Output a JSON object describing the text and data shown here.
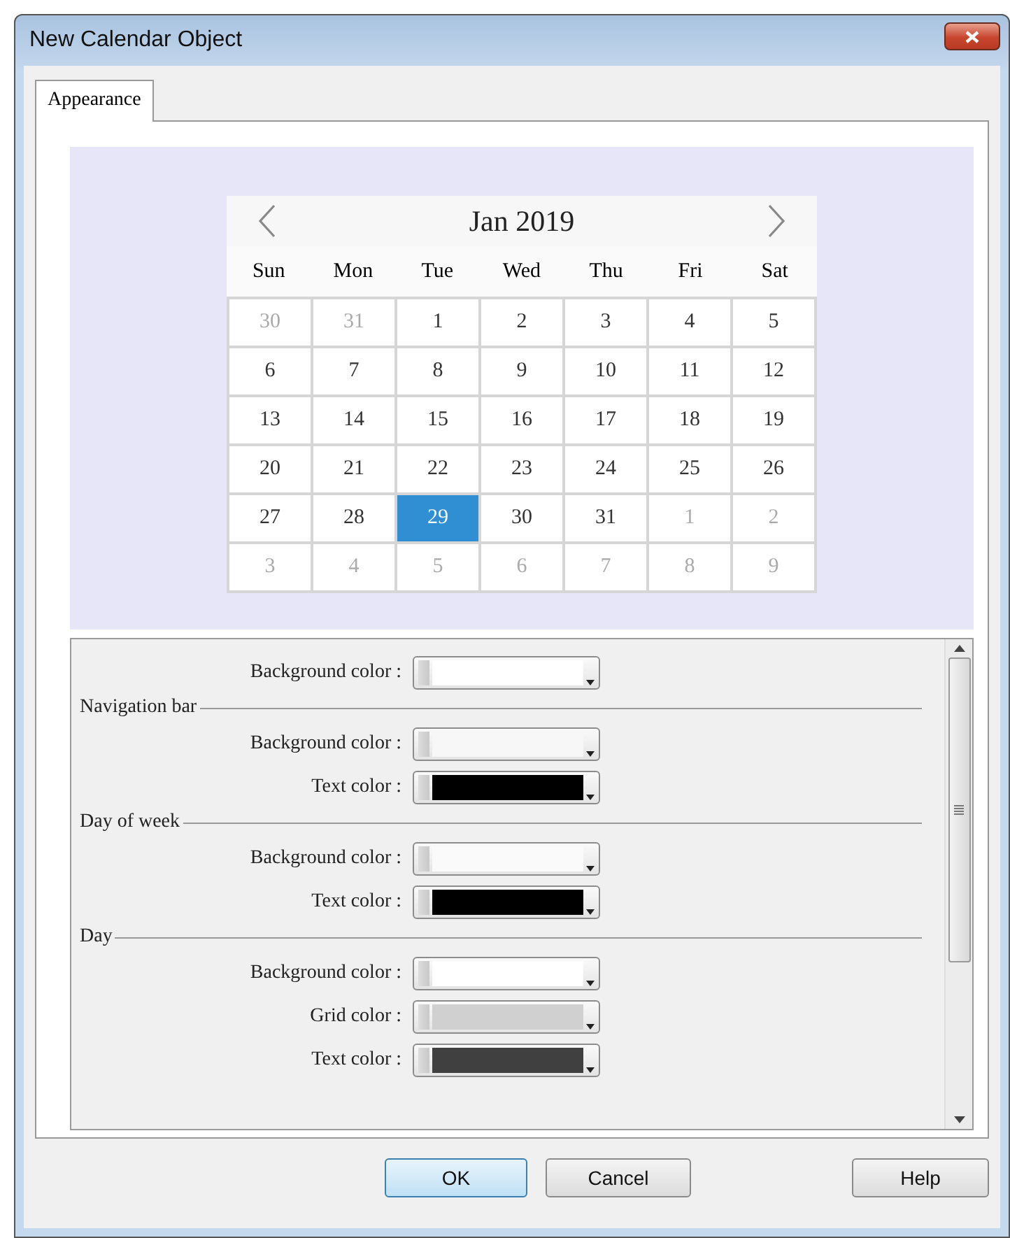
{
  "window": {
    "title": "New Calendar Object"
  },
  "tabs": [
    {
      "label": "Appearance",
      "selected": true
    }
  ],
  "calendar": {
    "title": "Jan 2019",
    "weekdays": [
      "Sun",
      "Mon",
      "Tue",
      "Wed",
      "Thu",
      "Fri",
      "Sat"
    ],
    "weeks": [
      [
        {
          "day": "30",
          "muted": true,
          "selected": false
        },
        {
          "day": "31",
          "muted": true,
          "selected": false
        },
        {
          "day": "1",
          "muted": false,
          "selected": false
        },
        {
          "day": "2",
          "muted": false,
          "selected": false
        },
        {
          "day": "3",
          "muted": false,
          "selected": false
        },
        {
          "day": "4",
          "muted": false,
          "selected": false
        },
        {
          "day": "5",
          "muted": false,
          "selected": false
        }
      ],
      [
        {
          "day": "6",
          "muted": false,
          "selected": false
        },
        {
          "day": "7",
          "muted": false,
          "selected": false
        },
        {
          "day": "8",
          "muted": false,
          "selected": false
        },
        {
          "day": "9",
          "muted": false,
          "selected": false
        },
        {
          "day": "10",
          "muted": false,
          "selected": false
        },
        {
          "day": "11",
          "muted": false,
          "selected": false
        },
        {
          "day": "12",
          "muted": false,
          "selected": false
        }
      ],
      [
        {
          "day": "13",
          "muted": false,
          "selected": false
        },
        {
          "day": "14",
          "muted": false,
          "selected": false
        },
        {
          "day": "15",
          "muted": false,
          "selected": false
        },
        {
          "day": "16",
          "muted": false,
          "selected": false
        },
        {
          "day": "17",
          "muted": false,
          "selected": false
        },
        {
          "day": "18",
          "muted": false,
          "selected": false
        },
        {
          "day": "19",
          "muted": false,
          "selected": false
        }
      ],
      [
        {
          "day": "20",
          "muted": false,
          "selected": false
        },
        {
          "day": "21",
          "muted": false,
          "selected": false
        },
        {
          "day": "22",
          "muted": false,
          "selected": false
        },
        {
          "day": "23",
          "muted": false,
          "selected": false
        },
        {
          "day": "24",
          "muted": false,
          "selected": false
        },
        {
          "day": "25",
          "muted": false,
          "selected": false
        },
        {
          "day": "26",
          "muted": false,
          "selected": false
        }
      ],
      [
        {
          "day": "27",
          "muted": false,
          "selected": false
        },
        {
          "day": "28",
          "muted": false,
          "selected": false
        },
        {
          "day": "29",
          "muted": false,
          "selected": true
        },
        {
          "day": "30",
          "muted": false,
          "selected": false
        },
        {
          "day": "31",
          "muted": false,
          "selected": false
        },
        {
          "day": "1",
          "muted": true,
          "selected": false
        },
        {
          "day": "2",
          "muted": true,
          "selected": false
        }
      ],
      [
        {
          "day": "3",
          "muted": true,
          "selected": false
        },
        {
          "day": "4",
          "muted": true,
          "selected": false
        },
        {
          "day": "5",
          "muted": true,
          "selected": false
        },
        {
          "day": "6",
          "muted": true,
          "selected": false
        },
        {
          "day": "7",
          "muted": true,
          "selected": false
        },
        {
          "day": "8",
          "muted": true,
          "selected": false
        },
        {
          "day": "9",
          "muted": true,
          "selected": false
        }
      ]
    ]
  },
  "properties": [
    {
      "kind": "color",
      "label": "Background color :",
      "color": "#ffffff"
    },
    {
      "kind": "section",
      "label": "Navigation bar"
    },
    {
      "kind": "color",
      "label": "Background color :",
      "color": "#f7f7f7"
    },
    {
      "kind": "color",
      "label": "Text color :",
      "color": "#000000"
    },
    {
      "kind": "section",
      "label": "Day of week"
    },
    {
      "kind": "color",
      "label": "Background color :",
      "color": "#fafafa"
    },
    {
      "kind": "color",
      "label": "Text color :",
      "color": "#000000"
    },
    {
      "kind": "section",
      "label": "Day"
    },
    {
      "kind": "color",
      "label": "Background color :",
      "color": "#ffffff"
    },
    {
      "kind": "color",
      "label": "Grid color :",
      "color": "#d0d0d0"
    },
    {
      "kind": "color",
      "label": "Text color :",
      "color": "#404040"
    }
  ],
  "buttons": [
    {
      "label": "OK",
      "kind": "default"
    },
    {
      "label": "Cancel",
      "kind": "normal"
    },
    {
      "label": "Help",
      "kind": "help"
    }
  ]
}
